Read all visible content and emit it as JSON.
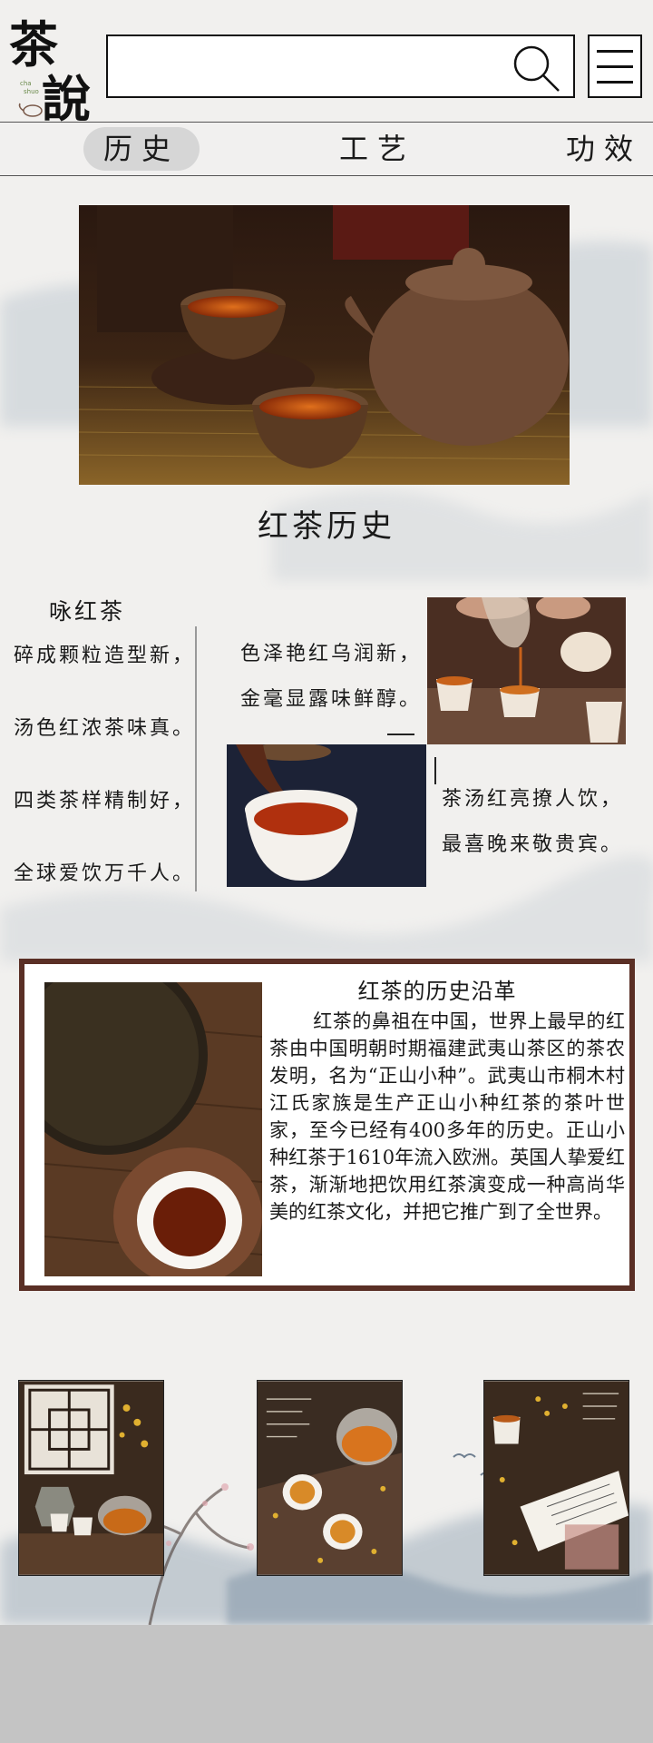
{
  "logo": {
    "main_text": "茶說",
    "pinyin": "cha shuo"
  },
  "search": {
    "value": "",
    "placeholder": ""
  },
  "nav": {
    "tabs": [
      {
        "label": "历史",
        "active": true
      },
      {
        "label": "工艺",
        "active": false
      },
      {
        "label": "功效",
        "active": false
      }
    ]
  },
  "section": {
    "title": "红茶历史"
  },
  "poem": {
    "title": "咏红茶",
    "left_lines": [
      "碎成颗粒造型新，",
      "汤色红浓茶味真。",
      "四类茶样精制好，",
      "全球爱饮万千人。"
    ],
    "right_top_lines": [
      "色泽艳红乌润新，",
      "金毫显露味鲜醇。"
    ],
    "right_bottom_lines": [
      "茶汤红亮撩人饮，",
      "最喜晚来敬贵宾。"
    ]
  },
  "history": {
    "title": "红茶的历史沿革",
    "text": "红茶的鼻祖在中国，世界上最早的红茶由中国明朝时期福建武夷山茶区的茶农发明，名为“正山小种”。武夷山市桐木村江氏家族是生产正山小种红茶的茶叶世家，至今已经有400多年的历史。正山小种红茶于1610年流入欧洲。英国人挚爱红茶，渐渐地把饮用红茶演变成一种高尚华美的红茶文化，并把它推广到了全世界。"
  },
  "colors": {
    "page_bg": "#f1f0ee",
    "bottom_bar": "#c4c4c4",
    "box_border": "#5a2f25",
    "tab_active": "#d6d6d6"
  },
  "icons": {
    "search": "search-icon",
    "menu": "menu-icon"
  }
}
